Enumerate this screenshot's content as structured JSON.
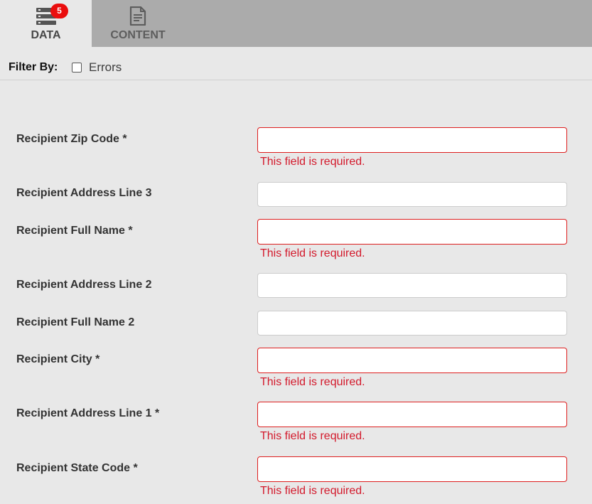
{
  "tabs": [
    {
      "label": "DATA",
      "icon": "list-icon",
      "badge": "5",
      "active": true
    },
    {
      "label": "CONTENT",
      "icon": "document-icon",
      "active": false
    }
  ],
  "filter": {
    "label": "Filter By:",
    "option_label": "Errors",
    "checked": false
  },
  "fields": [
    {
      "label": "Recipient Zip Code *",
      "value": "",
      "error": "This field is required."
    },
    {
      "label": "Recipient Address Line 3",
      "value": "",
      "error": ""
    },
    {
      "label": "Recipient Full Name *",
      "value": "",
      "error": "This field is required."
    },
    {
      "label": "Recipient Address Line 2",
      "value": "",
      "error": ""
    },
    {
      "label": "Recipient Full Name 2",
      "value": "",
      "error": ""
    },
    {
      "label": "Recipient City *",
      "value": "",
      "error": "This field is required."
    },
    {
      "label": "Recipient Address Line 1 *",
      "value": "",
      "error": "This field is required."
    },
    {
      "label": "Recipient State Code *",
      "value": "",
      "error": "This field is required."
    }
  ],
  "colors": {
    "error": "#d3192b",
    "invalid_border": "#dd1e1e",
    "badge": "#ea0d0d",
    "tabbar": "#ababab",
    "background": "#e8e8e8"
  }
}
